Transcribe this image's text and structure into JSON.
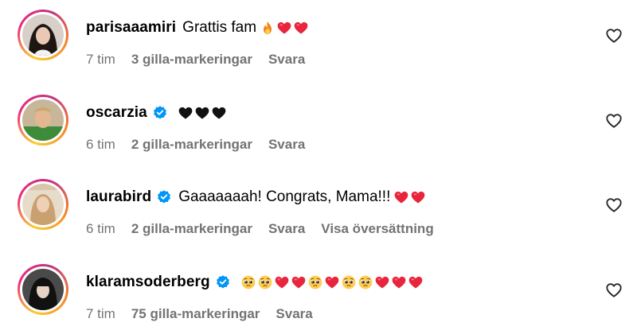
{
  "comments": [
    {
      "username": "parisaaamiri",
      "verified": false,
      "text": "Grattis fam",
      "emoji": [
        "fire",
        "red-heart",
        "red-heart"
      ],
      "time": "7 tim",
      "likes": "3 gilla-markeringar",
      "reply": "Svara",
      "translate": ""
    },
    {
      "username": "oscarzia",
      "verified": true,
      "text": "",
      "emoji": [
        "black-heart",
        "black-heart",
        "black-heart"
      ],
      "time": "6 tim",
      "likes": "2 gilla-markeringar",
      "reply": "Svara",
      "translate": ""
    },
    {
      "username": "laurabird",
      "verified": true,
      "text": "Gaaaaaaah! Congrats, Mama!!!",
      "emoji": [
        "red-heart",
        "red-heart"
      ],
      "time": "6 tim",
      "likes": "2 gilla-markeringar",
      "reply": "Svara",
      "translate": "Visa översättning"
    },
    {
      "username": "klaramsoderberg",
      "verified": true,
      "text": "",
      "emoji": [
        "pleading-face",
        "pleading-face",
        "red-heart",
        "red-heart",
        "pleading-face",
        "red-heart",
        "pleading-face",
        "pleading-face",
        "red-heart",
        "red-heart",
        "red-heart"
      ],
      "time": "7 tim",
      "likes": "75 gilla-markeringar",
      "reply": "Svara",
      "translate": ""
    }
  ],
  "colors": {
    "verified_blue": "#0095f6",
    "meta_gray": "#737373",
    "heart_red": "#e8253c"
  }
}
